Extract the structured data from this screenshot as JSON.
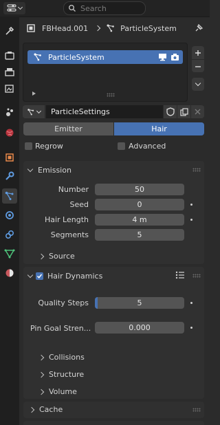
{
  "header": {
    "search_placeholder": "Search"
  },
  "breadcrumb": {
    "object": "FBHead.001",
    "system": "ParticleSystem"
  },
  "particle_list": {
    "items": [
      {
        "label": "ParticleSystem",
        "selected": true
      }
    ]
  },
  "settings": {
    "name": "ParticleSettings"
  },
  "type_tabs": {
    "emitter": "Emitter",
    "hair": "Hair",
    "active": "Hair"
  },
  "options": {
    "regrow": "Regrow",
    "advanced": "Advanced"
  },
  "emission": {
    "title": "Emission",
    "number_label": "Number",
    "number_value": "50",
    "seed_label": "Seed",
    "seed_value": "0",
    "hair_length_label": "Hair Length",
    "hair_length_value": "4 m",
    "segments_label": "Segments",
    "segments_value": "5",
    "source_label": "Source"
  },
  "hair_dynamics": {
    "title": "Hair Dynamics",
    "enabled": true,
    "quality_steps_label": "Quality Steps",
    "quality_steps_value": "5",
    "pin_goal_label": "Pin Goal Stren...",
    "pin_goal_value": "0.000",
    "collisions_label": "Collisions",
    "structure_label": "Structure",
    "volume_label": "Volume"
  },
  "cache": {
    "title": "Cache"
  },
  "colors": {
    "accent": "#4772b3",
    "panel_bg": "#303030",
    "field_bg": "#545454",
    "window_bg": "#2b2b2b"
  }
}
